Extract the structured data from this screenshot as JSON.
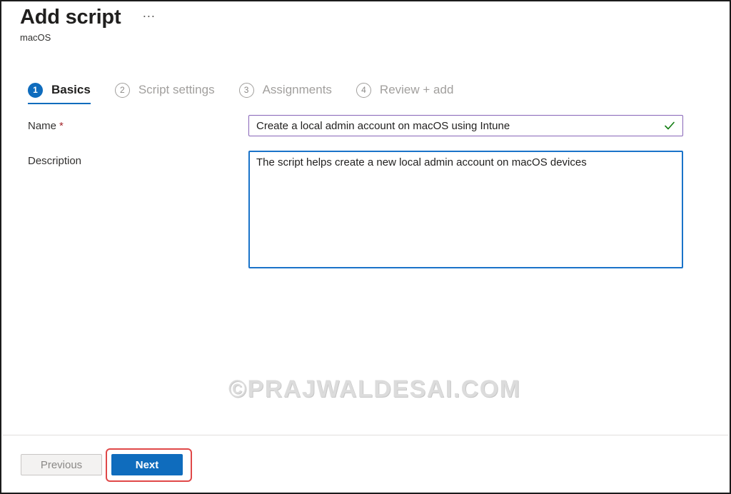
{
  "header": {
    "title": "Add script",
    "more_label": "···",
    "subtitle": "macOS"
  },
  "wizard": {
    "steps": [
      {
        "number": "1",
        "label": "Basics",
        "active": true
      },
      {
        "number": "2",
        "label": "Script settings",
        "active": false
      },
      {
        "number": "3",
        "label": "Assignments",
        "active": false
      },
      {
        "number": "4",
        "label": "Review + add",
        "active": false
      }
    ]
  },
  "form": {
    "name_label": "Name",
    "required_marker": "*",
    "name_value": "Create a local admin account on macOS using Intune",
    "description_label": "Description",
    "description_value": "The script helps create a new local admin account on macOS devices"
  },
  "watermark": "©PRAJWALDESAI.COM",
  "footer": {
    "previous_label": "Previous",
    "next_label": "Next"
  },
  "colors": {
    "accent": "#0f6cbd",
    "valid_check": "#107c10",
    "highlight": "#e04848"
  },
  "icons": {
    "more": "ellipsis-icon",
    "valid": "checkmark-icon"
  }
}
